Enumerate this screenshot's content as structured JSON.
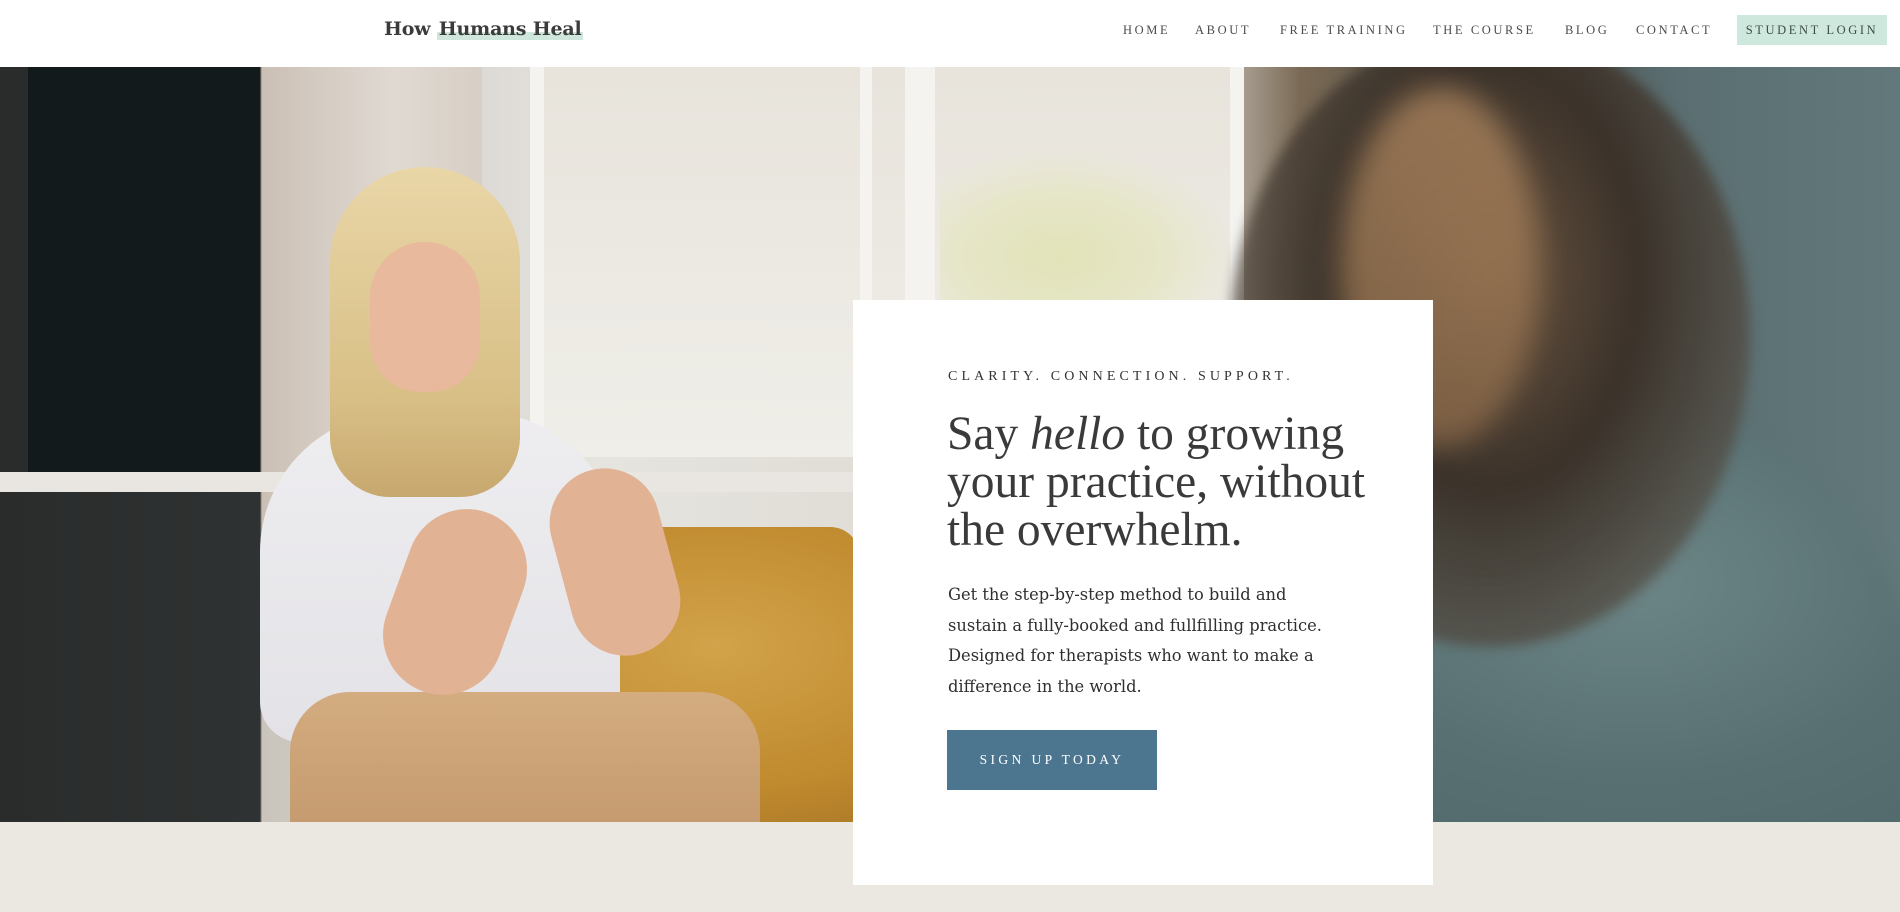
{
  "header": {
    "logo_prefix": "How ",
    "logo_highlight": "Humans Heal",
    "nav": [
      {
        "label": "HOME"
      },
      {
        "label": "ABOUT"
      },
      {
        "label": "FREE TRAINING"
      },
      {
        "label": "THE COURSE"
      },
      {
        "label": "BLOG"
      },
      {
        "label": "CONTACT"
      }
    ],
    "login_label": "STUDENT LOGIN"
  },
  "hero": {
    "eyebrow": "CLARITY. CONNECTION. SUPPORT.",
    "headline_before": "Say ",
    "headline_em": "hello",
    "headline_after": " to growing your practice, without the overwhelm.",
    "body": "Get the step-by-step method to build and sustain a fully-booked and fullfilling practice.  Designed for therapists who want to make a difference in the world.",
    "cta_label": "SIGN UP TODAY"
  },
  "colors": {
    "accent_button": "#4c7690",
    "login_bg": "#cfe8de",
    "band_bg": "#ebe7e1"
  }
}
